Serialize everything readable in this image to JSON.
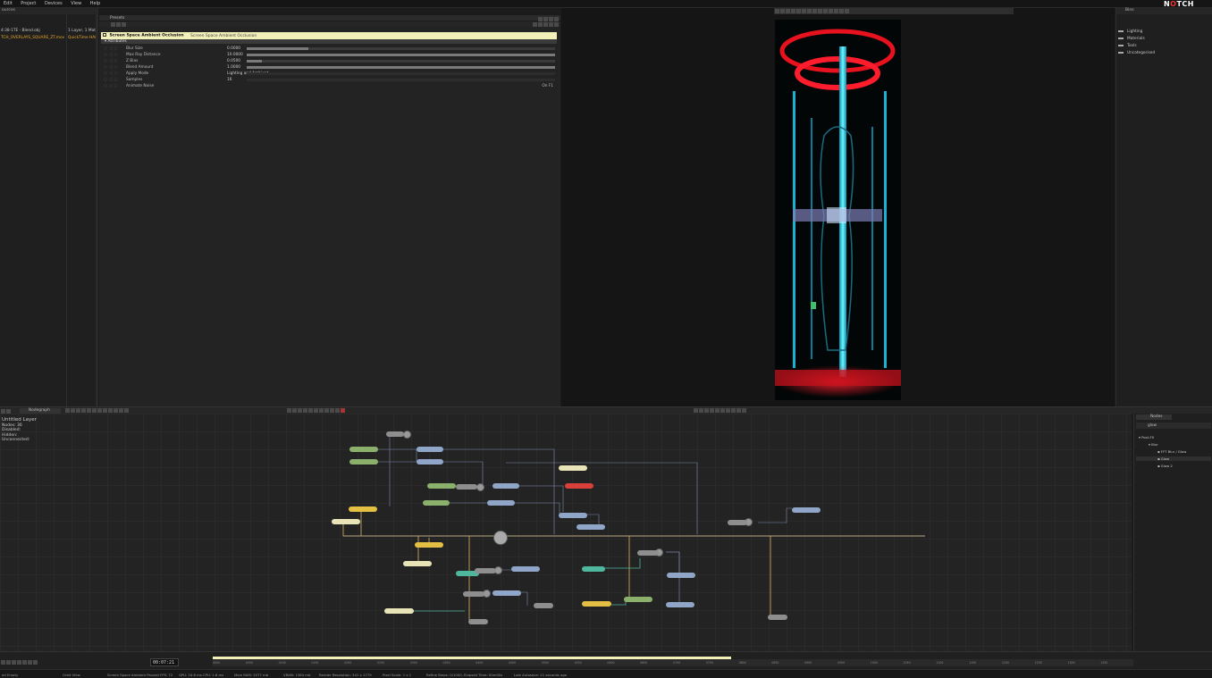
{
  "menu": [
    "Edit",
    "Project",
    "Devices",
    "View",
    "Help"
  ],
  "logo": {
    "text": "N",
    "accent": "O",
    "rest": "TCH"
  },
  "left_panel": {
    "header": "ources",
    "files": [
      {
        "name": "4:38-1TE - Blend.obj",
        "info": "1 Layer, 1 Mats",
        "color": "#c8c8c8"
      },
      {
        "name": "TCH_OVERLAYS_SQUARE_ZT.mov",
        "info": "QuickTime HAI",
        "color": "#e8a62c"
      }
    ]
  },
  "properties": {
    "tab": "Presets",
    "node_title": "Screen Space Ambient Occlusion",
    "node_type": "Screen Space Ambient Occlusion",
    "section": "Attributes",
    "rows": [
      {
        "name": "Blur Size",
        "value": "0.0000",
        "fill": 0.2
      },
      {
        "name": "Max Ray Distance",
        "value": "10.0000",
        "fill": 1.0
      },
      {
        "name": "Z Bias",
        "value": "0.0500",
        "fill": 0.05
      },
      {
        "name": "Blend Amount",
        "value": "1.0000",
        "fill": 1.0
      },
      {
        "name": "Apply Mode",
        "value": "Lighting and Ambient",
        "fill": null
      },
      {
        "name": "Samples",
        "value": "16",
        "fill": null
      },
      {
        "name": "Animate Noise",
        "value": "",
        "right": "On F1",
        "fill": null
      }
    ]
  },
  "bins": {
    "header": "Bins",
    "items": [
      "Lighting",
      "Materials",
      "Tools",
      "Uncategorised"
    ]
  },
  "nodegraph": {
    "tab": "Nodegraph",
    "layer": "Untitled  Layer",
    "info": [
      "Nodes: 36",
      "Disabled:",
      "Hidden:",
      "Unconnected:"
    ]
  },
  "nodes_panel": {
    "tab": "Nodes",
    "search": "glow",
    "tree": [
      {
        "label": "Post-FX",
        "indent": 0
      },
      {
        "label": "Blur",
        "indent": 1
      },
      {
        "label": "FFT Blur / Glow",
        "indent": 2
      },
      {
        "label": "Glow",
        "indent": 2,
        "selected": true
      },
      {
        "label": "Glow 2",
        "indent": 2
      }
    ]
  },
  "timeline": {
    "timecode": "00:07:21",
    "ticks": [
      "0000",
      "0050",
      "0100",
      "0150",
      "0200",
      "0250",
      "0300",
      "0350",
      "0400",
      "0450",
      "0500",
      "0550",
      "0600",
      "0650",
      "0700",
      "0750",
      "0800",
      "0850",
      "0900",
      "0950",
      "1000",
      "1050",
      "1100",
      "1150",
      "1200",
      "1250",
      "1300",
      "1350"
    ]
  },
  "status": [
    {
      "text": "ed Empty"
    },
    {
      "text": "Orbit View"
    },
    {
      "text": "Screen Space Ambient  Paused  FPS: 72"
    },
    {
      "text": "GPU: 16.6 ms  CPU: 1.6 ms"
    },
    {
      "text": "Main RAM: 1577 mb"
    },
    {
      "text": "VRAM: 1384 mb"
    },
    {
      "text": "Render Resolution: 341 x 1779"
    },
    {
      "text": "Pixel Scale: 1 x 1"
    },
    {
      "text": "Refine Steps: 0/1000, Elapsed Time: 00m00s"
    },
    {
      "text": "Last Autosave: 21 seconds ago"
    }
  ],
  "colors": {
    "accent_yellow": "#f2efb8",
    "node_green": "#8bb06c",
    "node_blue": "#8fa6c8",
    "node_yellow": "#e3c043",
    "node_red": "#d8413b",
    "node_teal": "#4fb79e",
    "render_cyan": "#2ad6f0",
    "render_red": "#ff1c2c"
  }
}
